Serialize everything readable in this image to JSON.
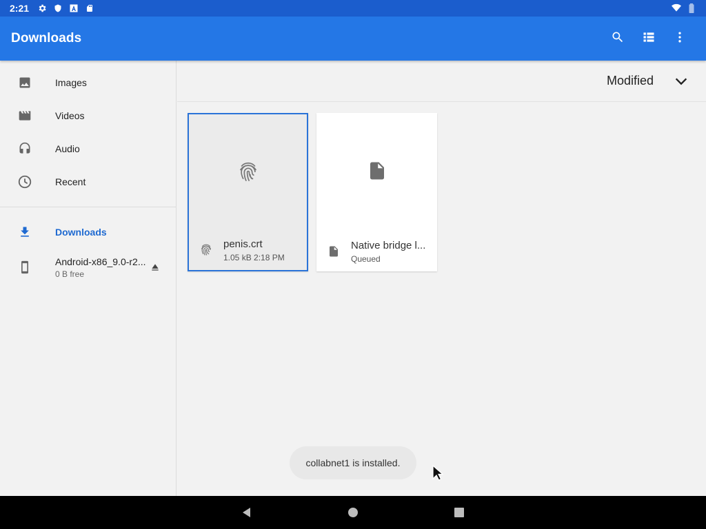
{
  "status_bar": {
    "time": "2:21",
    "left_icons": [
      "settings-icon",
      "shield-icon",
      "font-icon",
      "sd-card-icon"
    ],
    "right_icons": [
      "wifi-icon",
      "battery-icon"
    ]
  },
  "app_bar": {
    "title": "Downloads",
    "actions": [
      "search-icon",
      "list-view-icon",
      "more-vert-icon"
    ]
  },
  "sidebar": {
    "items": [
      {
        "label": "Images",
        "icon": "image-icon"
      },
      {
        "label": "Videos",
        "icon": "movie-icon"
      },
      {
        "label": "Audio",
        "icon": "headphones-icon"
      },
      {
        "label": "Recent",
        "icon": "clock-icon"
      }
    ],
    "downloads": {
      "label": "Downloads",
      "icon": "download-icon",
      "active": true
    },
    "root": {
      "title": "Android-x86_9.0-r2...",
      "subtitle": "0 B free",
      "icon": "phone-icon",
      "eject_icon": "eject-icon"
    }
  },
  "sort": {
    "label": "Modified",
    "icon": "chevron-down-icon"
  },
  "files": [
    {
      "name": "penis.crt",
      "meta": "1.05 kB 2:18 PM",
      "icon": "fingerprint-icon",
      "selected": true
    },
    {
      "name": "Native bridge l...",
      "meta": "Queued",
      "icon": "file-icon",
      "selected": false
    }
  ],
  "toast": {
    "text": "collabnet1 is installed."
  },
  "colors": {
    "status_bar": "#1b5dcd",
    "app_bar": "#2477e6",
    "accent": "#1f6ad1",
    "selection_border": "#2a73d8"
  }
}
